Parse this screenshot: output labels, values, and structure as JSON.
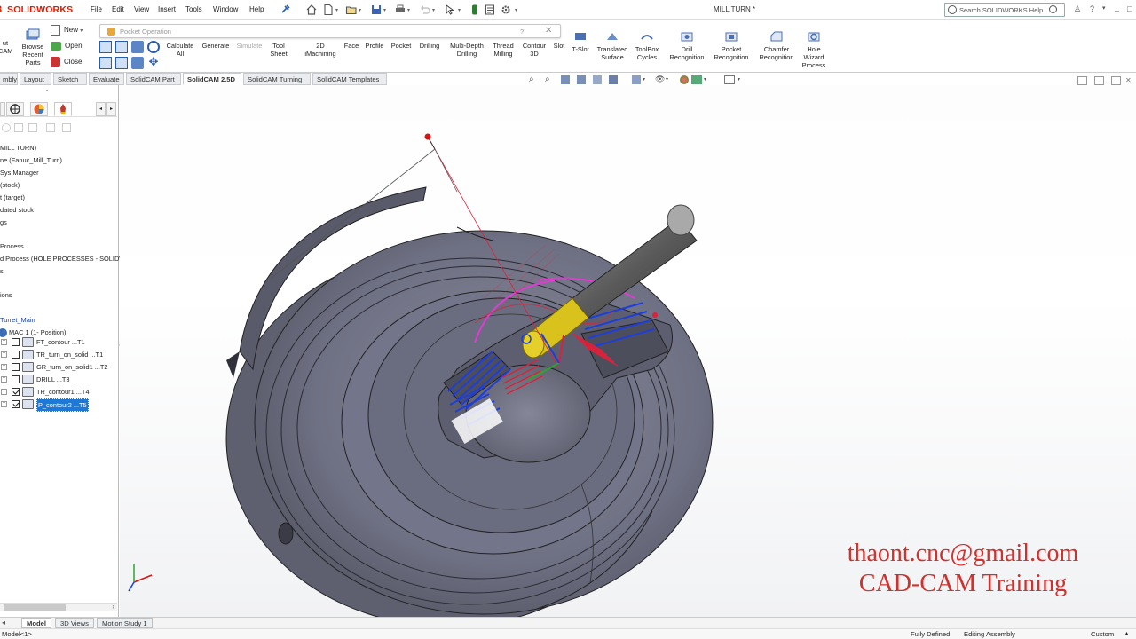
{
  "app": {
    "brand": "SOLIDWORKS",
    "document_title": "MILL TURN *"
  },
  "menu": [
    "File",
    "Edit",
    "View",
    "Insert",
    "Tools",
    "Window",
    "Help"
  ],
  "search": {
    "placeholder": "Search SOLIDWORKS Help"
  },
  "popup": {
    "title": "Pocket Operation",
    "help": "?",
    "close": "✕"
  },
  "ribbon": {
    "left_group": {
      "new": "New",
      "open": "Open",
      "close": "Close",
      "browse": "Browse Recent Parts",
      "browse_l1": "Browse",
      "browse_l2": "Recent",
      "browse_l3": "Parts",
      "left_cut_l1": "ut",
      "left_cut_l2": "CAM"
    },
    "buttons": [
      {
        "l1": "Calculate",
        "l2": "All"
      },
      {
        "l1": "Generate",
        "l2": ""
      },
      {
        "l1": "Simulate",
        "l2": ""
      },
      {
        "l1": "Tool",
        "l2": "Sheet"
      },
      {
        "l1": "2D",
        "l2": "iMachining"
      },
      {
        "l1": "Face",
        "l2": ""
      },
      {
        "l1": "Profile",
        "l2": ""
      },
      {
        "l1": "Pocket",
        "l2": ""
      },
      {
        "l1": "Drilling",
        "l2": ""
      },
      {
        "l1": "Multi-Depth",
        "l2": "Drilling"
      },
      {
        "l1": "Thread",
        "l2": "Milling"
      },
      {
        "l1": "Contour",
        "l2": "3D"
      },
      {
        "l1": "Slot",
        "l2": ""
      },
      {
        "l1": "T-Slot",
        "l2": ""
      },
      {
        "l1": "Translated",
        "l2": "Surface"
      },
      {
        "l1": "ToolBox",
        "l2": "Cycles"
      },
      {
        "l1": "Drill",
        "l2": "Recognition"
      },
      {
        "l1": "Pocket",
        "l2": "Recognition"
      },
      {
        "l1": "Chamfer",
        "l2": "Recognition"
      },
      {
        "l1": "Hole",
        "l2": "Wizard",
        "l3": "Process"
      }
    ]
  },
  "tabs": [
    "mbly",
    "Layout",
    "Sketch",
    "Evaluate",
    "SolidCAM Part",
    "SolidCAM 2.5D",
    "SolidCAM Turning",
    "SolidCAM Templates"
  ],
  "active_tab": "SolidCAM 2.5D",
  "tree": {
    "items": [
      "MILL TURN)",
      "ne (Fanuc_Mill_Turn)",
      "Sys Manager",
      "(stock)",
      "t (target)",
      "dated stock",
      "gs",
      "Process",
      "d Process (HOLE PROCESSES - SOLIDW",
      "s",
      "ions",
      "Turret_Main",
      "MAC 1 (1- Position)"
    ],
    "operations": [
      {
        "label": "FT_contour ...T1",
        "checked": false
      },
      {
        "label": "TR_turn_on_solid ...T1",
        "checked": false
      },
      {
        "label": "GR_turn_on_solid1 ...T2",
        "checked": false
      },
      {
        "label": "DRILL ...T3",
        "checked": false
      },
      {
        "label": "TR_contour1 ...T4",
        "checked": true
      },
      {
        "label": "P_contour2 ...T5",
        "checked": true
      }
    ]
  },
  "bottom_tabs": [
    "Model",
    "3D Views",
    "Motion Study 1"
  ],
  "status": {
    "left": "Model<1>",
    "defined": "Fully Defined",
    "mode": "Editing Assembly",
    "units": "Custom"
  },
  "watermark": {
    "email": "thaont.cnc@gmail.com",
    "training": "CAD-CAM Training"
  },
  "colors": {
    "brand_red": "#d81e05",
    "part_body": "#6e7083",
    "toolpath_blue": "#1f3ed9",
    "toolpath_red": "#e0203a",
    "tool_holder": "#d9c21b",
    "watermark_red": "#d0312d"
  }
}
